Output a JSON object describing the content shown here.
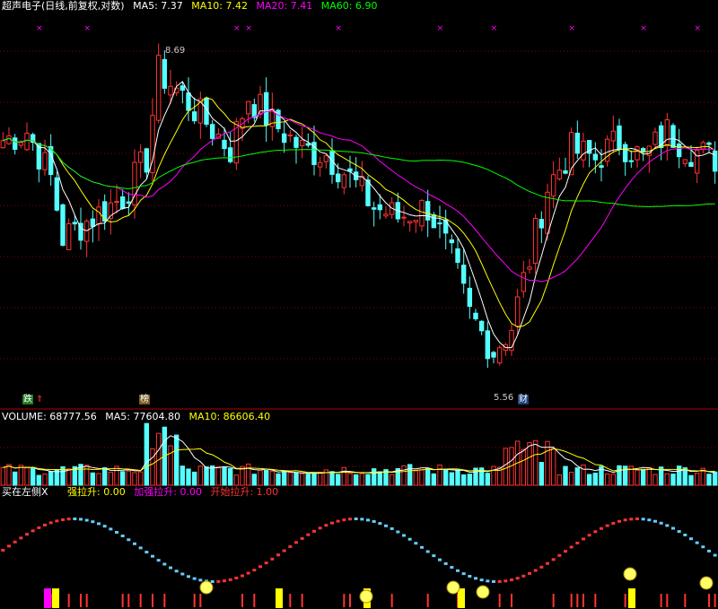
{
  "main_panel": {
    "stock_name": "超声电子",
    "chart_mode": "(日线,前复权,对数)",
    "ma": [
      {
        "label": "MA5: 7.37",
        "color": "#ffffff"
      },
      {
        "label": "MA10: 7.42",
        "color": "#ffff00"
      },
      {
        "label": "MA20: 7.41",
        "color": "#ff00ff"
      },
      {
        "label": "MA60: 6.90",
        "color": "#00ff00"
      }
    ],
    "high_label": "8.69",
    "low_label": "5.56",
    "tag_left": "跌",
    "tag_left_icon": "double-up-arrow",
    "tag_mid": "榜",
    "tag_cai": "财"
  },
  "volume_panel": {
    "label": "VOLUME: 68777.56",
    "ma5": "MA5: 77604.80",
    "ma10": "MA10: 86606.40",
    "colors": {
      "label": "#ffffff",
      "ma5": "#ffffff",
      "ma10": "#ffff00"
    }
  },
  "indicator_panel": {
    "name": "买在左侧X",
    "items": [
      {
        "label": "强拉升: 0.00",
        "color": "#ffff00"
      },
      {
        "label": "加强拉升: 0.00",
        "color": "#ff00ff"
      },
      {
        "label": "开始拉升: 1.00",
        "color": "#ff3333"
      }
    ]
  },
  "colors": {
    "up": "#ff3333",
    "down": "#54ffff",
    "ma5": "#ffffff",
    "ma10": "#ffff00",
    "ma20": "#ff00ff",
    "ma60": "#00ff00",
    "grid": "#8b0000",
    "axis": "#b00000"
  },
  "chart_data": {
    "type": "candlestick",
    "scale": "log",
    "ylim": [
      5.3,
      9.1
    ],
    "grid": true,
    "candle_count": 120,
    "high": 8.69,
    "low": 5.56,
    "ma60_last": 6.9
  }
}
